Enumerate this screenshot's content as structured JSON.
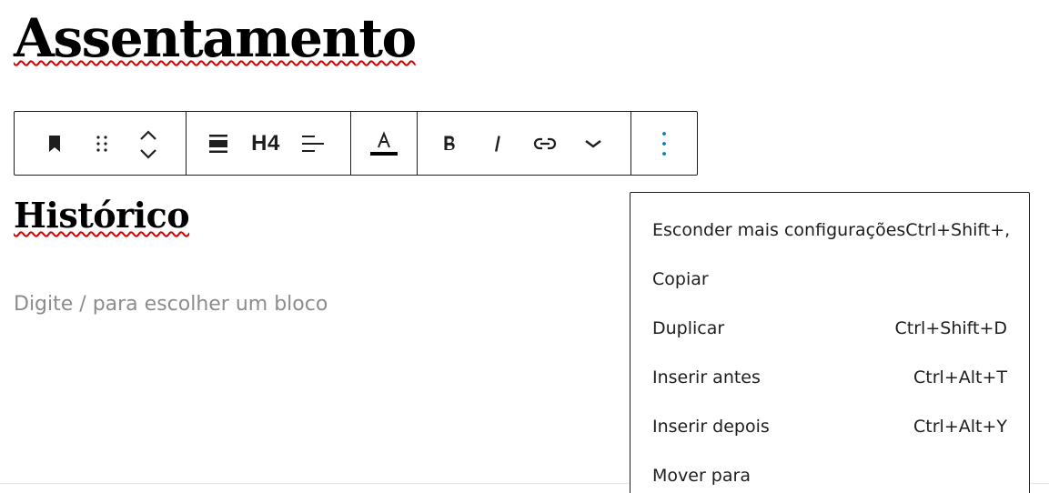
{
  "page": {
    "title": "Assentamento",
    "selected_heading": "Histórico",
    "block_placeholder": "Digite / para escolher um bloco"
  },
  "toolbar": {
    "heading_level": "H4",
    "icons": [
      "bookmark-icon",
      "drag-handle-icon",
      "move-up-icon",
      "move-down-icon",
      "align-wide-icon",
      "text-align-left-icon",
      "text-color-icon",
      "bold-icon",
      "italic-icon",
      "link-icon",
      "chevron-down-icon",
      "more-options-icon"
    ],
    "accent_color": "#007cba"
  },
  "options_menu": {
    "items": [
      {
        "label": "Esconder mais configurações",
        "shortcut": "Ctrl+Shift+,"
      },
      {
        "label": "Copiar",
        "shortcut": ""
      },
      {
        "label": "Duplicar",
        "shortcut": "Ctrl+Shift+D"
      },
      {
        "label": "Inserir antes",
        "shortcut": "Ctrl+Alt+T"
      },
      {
        "label": "Inserir depois",
        "shortcut": "Ctrl+Alt+Y"
      },
      {
        "label": "Mover para",
        "shortcut": ""
      }
    ]
  },
  "colors": {
    "spellcheck_underline": "#d40000",
    "border": "#1e1e1e",
    "placeholder": "#8c8c8c"
  }
}
